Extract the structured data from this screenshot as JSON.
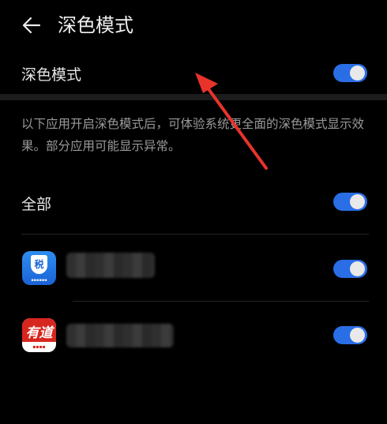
{
  "header": {
    "title": "深色模式"
  },
  "main_toggle": {
    "label": "深色模式",
    "on": true
  },
  "description": "以下应用开启深色模式后，可体验系统更全面的深色模式显示效果。部分应用可能显示异常。",
  "all_toggle": {
    "label": "全部",
    "on": true
  },
  "apps": [
    {
      "name": "",
      "icon": "tax-app-icon",
      "icon_text": "税",
      "on": true
    },
    {
      "name": "",
      "icon": "youdao-dict-icon",
      "icon_text": "有道",
      "on": true
    }
  ],
  "colors": {
    "accent": "#2a6ee6",
    "background": "#000000",
    "annotation": "#e8332b"
  }
}
